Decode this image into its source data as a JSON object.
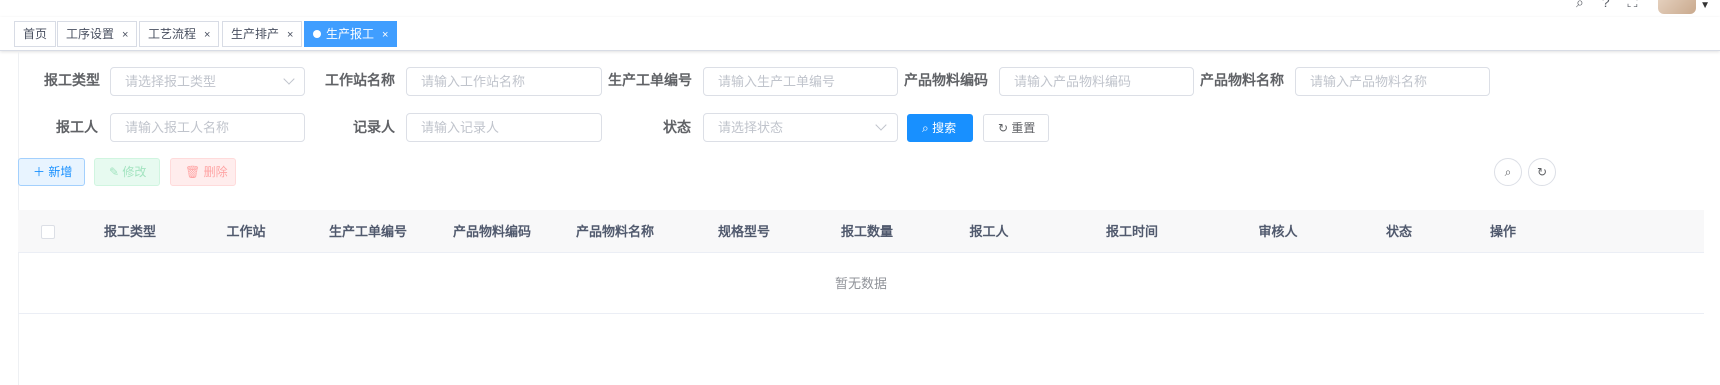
{
  "tags": [
    {
      "label": "首页",
      "closable": false
    },
    {
      "label": "工序设置",
      "closable": true
    },
    {
      "label": "工艺流程",
      "closable": true
    },
    {
      "label": "生产排产",
      "closable": true
    },
    {
      "label": "生产报工",
      "closable": true,
      "active": true
    }
  ],
  "close_glyph": "×",
  "form": {
    "report_type": {
      "label": "报工类型",
      "placeholder": "请选择报工类型"
    },
    "workstation": {
      "label": "工作站名称",
      "placeholder": "请输入工作站名称"
    },
    "work_order": {
      "label": "生产工单编号",
      "placeholder": "请输入生产工单编号"
    },
    "item_code": {
      "label": "产品物料编码",
      "placeholder": "请输入产品物料编码"
    },
    "item_name": {
      "label": "产品物料名称",
      "placeholder": "请输入产品物料名称"
    },
    "reporter": {
      "label": "报工人",
      "placeholder": "请输入报工人名称"
    },
    "recorder": {
      "label": "记录人",
      "placeholder": "请输入记录人"
    },
    "status": {
      "label": "状态",
      "placeholder": "请选择状态"
    },
    "search_label": "搜索",
    "reset_label": "重置"
  },
  "toolbar": {
    "add_label": "新增",
    "edit_label": "修改",
    "delete_label": "删除"
  },
  "table": {
    "columns": [
      "报工类型",
      "工作站",
      "生产工单编号",
      "产品物料编码",
      "产品物料名称",
      "规格型号",
      "报工数量",
      "报工人",
      "报工时间",
      "审核人",
      "状态",
      "操作"
    ],
    "empty_text": "暂无数据"
  },
  "colors": {
    "primary": "#1890ff",
    "tag_active": "#409eff"
  }
}
